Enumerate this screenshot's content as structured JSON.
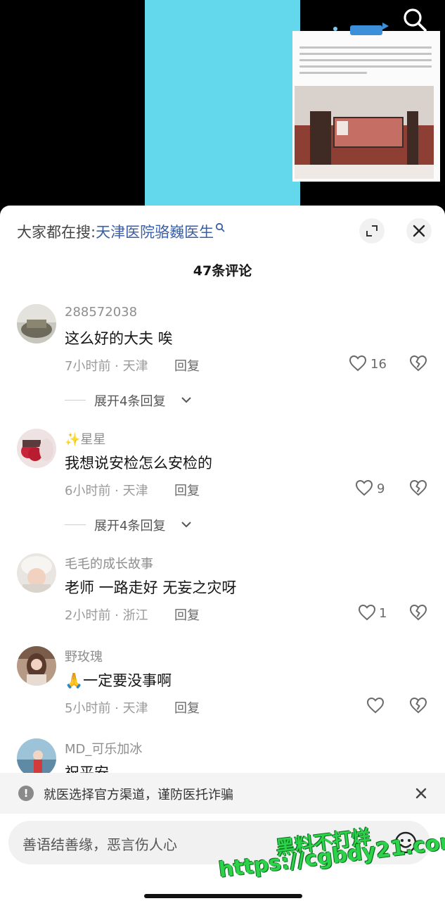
{
  "header": {
    "hot_search_prefix": "大家都在搜:",
    "hot_search_link": "天津医院骆巍医生"
  },
  "comments_panel": {
    "count_title": "47条评论",
    "comments": [
      {
        "username": "288572038",
        "text": "这么好的大夫 唉",
        "meta": "7小时前 · 天津",
        "reply_label": "回复",
        "likes": "16",
        "expand_label": "展开4条回复"
      },
      {
        "username": "✨星星",
        "text": "我想说安检怎么安检的",
        "meta": "6小时前 · 天津",
        "reply_label": "回复",
        "likes": "9",
        "expand_label": "展开4条回复"
      },
      {
        "username": "毛毛的成长故事",
        "text": "老师 一路走好 无妄之灾呀",
        "meta": "2小时前 · 浙江",
        "reply_label": "回复",
        "likes": "1"
      },
      {
        "username": "野玫瑰",
        "text": "🙏一定要没事啊",
        "meta": "5小时前 · 天津",
        "reply_label": "回复",
        "likes": ""
      },
      {
        "username": "MD_可乐加冰",
        "text": "祝平安"
      }
    ]
  },
  "notice": {
    "text": "就医选择官方渠道，谨防医托诈骗"
  },
  "input": {
    "placeholder": "善语结善缘，恶言伤人心"
  },
  "watermark": {
    "line1": "黑料不打烊",
    "line2": "https://cgbdy21.com"
  },
  "icons": {
    "search": "search-icon",
    "expand": "expand-icon",
    "close": "close-icon",
    "like": "heart-icon",
    "dislike": "broken-heart-icon",
    "notice": "info-icon",
    "emoji": "emoji-icon"
  },
  "colors": {
    "link": "#3a5ea8",
    "video_frame": "#63d7ec",
    "watermark": "#2bd24a"
  }
}
